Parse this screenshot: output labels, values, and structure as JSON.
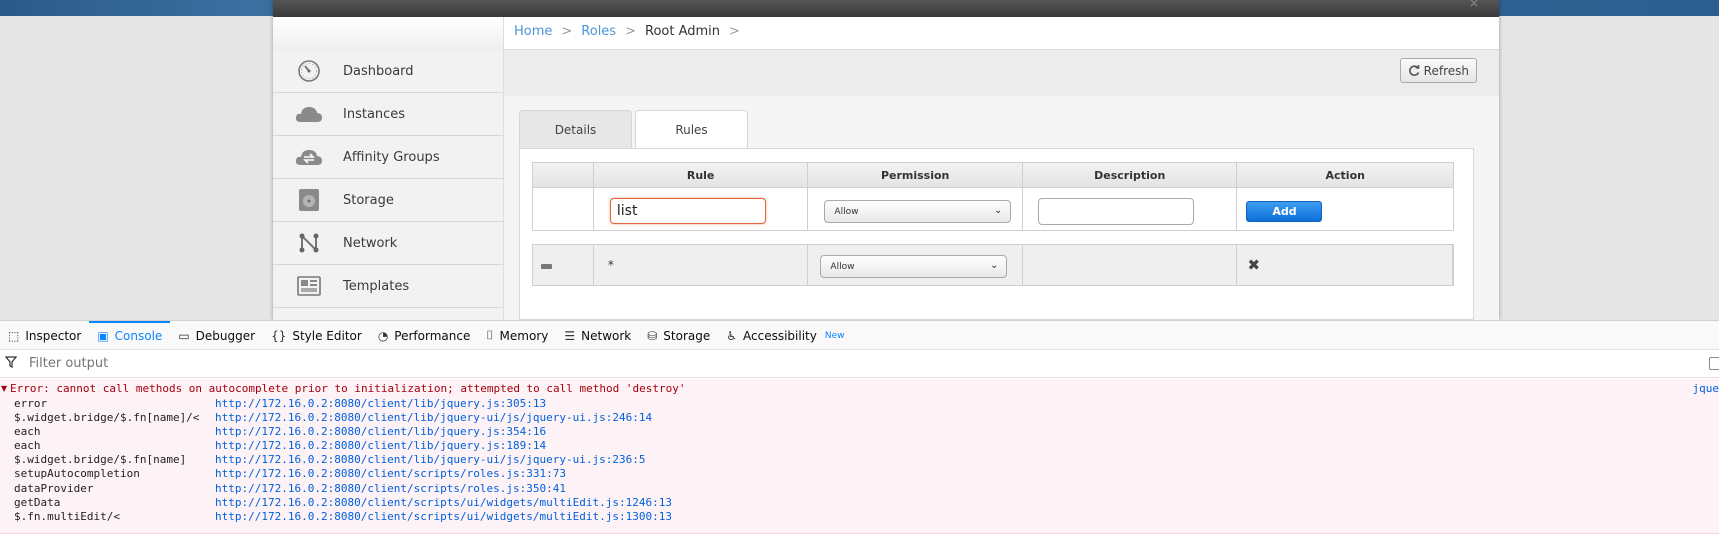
{
  "breadcrumb": {
    "home": "Home",
    "roles": "Roles",
    "current": "Root Admin",
    "sep": ">"
  },
  "toolbar": {
    "refresh_label": "Refresh"
  },
  "sidebar": {
    "items": [
      {
        "label": "Dashboard",
        "icon": "dashboard-icon"
      },
      {
        "label": "Instances",
        "icon": "cloud-icon"
      },
      {
        "label": "Affinity Groups",
        "icon": "affinity-icon"
      },
      {
        "label": "Storage",
        "icon": "storage-icon"
      },
      {
        "label": "Network",
        "icon": "network-icon"
      },
      {
        "label": "Templates",
        "icon": "templates-icon"
      }
    ]
  },
  "tabs": {
    "details": "Details",
    "rules": "Rules"
  },
  "rules_table": {
    "headers": {
      "rule": "Rule",
      "permission": "Permission",
      "description": "Description",
      "action": "Action"
    },
    "new_rule": {
      "rule_value": "list",
      "permission": "Allow",
      "add_label": "Add"
    },
    "rows": [
      {
        "rule": "*",
        "permission": "Allow"
      }
    ]
  },
  "devtools": {
    "tabs": {
      "inspector": "Inspector",
      "console": "Console",
      "debugger": "Debugger",
      "style_editor": "Style Editor",
      "performance": "Performance",
      "memory": "Memory",
      "network": "Network",
      "storage": "Storage",
      "accessibility": "Accessibility",
      "new_badge": "New"
    },
    "filter_placeholder": "Filter output",
    "error": {
      "message": "Error: cannot call methods on autocomplete prior to initialization; attempted to call method 'destroy'",
      "source": "jque",
      "stack": [
        {
          "fn": "error",
          "loc": "http://172.16.0.2:8080/client/lib/jquery.js:305:13"
        },
        {
          "fn": "$.widget.bridge/$.fn[name]/<",
          "loc": "http://172.16.0.2:8080/client/lib/jquery-ui/js/jquery-ui.js:246:14"
        },
        {
          "fn": "each",
          "loc": "http://172.16.0.2:8080/client/lib/jquery.js:354:16"
        },
        {
          "fn": "each",
          "loc": "http://172.16.0.2:8080/client/lib/jquery.js:189:14"
        },
        {
          "fn": "$.widget.bridge/$.fn[name]",
          "loc": "http://172.16.0.2:8080/client/lib/jquery-ui/js/jquery-ui.js:236:5"
        },
        {
          "fn": "setupAutocompletion",
          "loc": "http://172.16.0.2:8080/client/scripts/roles.js:331:73"
        },
        {
          "fn": "dataProvider",
          "loc": "http://172.16.0.2:8080/client/scripts/roles.js:350:41"
        },
        {
          "fn": "getData",
          "loc": "http://172.16.0.2:8080/client/scripts/ui/widgets/multiEdit.js:1246:13"
        },
        {
          "fn": "$.fn.multiEdit/<",
          "loc": "http://172.16.0.2:8080/client/scripts/ui/widgets/multiEdit.js:1300:13"
        }
      ]
    }
  },
  "colors": {
    "link": "#4d95d6",
    "error": "#a4000f",
    "devtools_accent": "#0a84ff",
    "add_button": "#0b6fd8"
  }
}
